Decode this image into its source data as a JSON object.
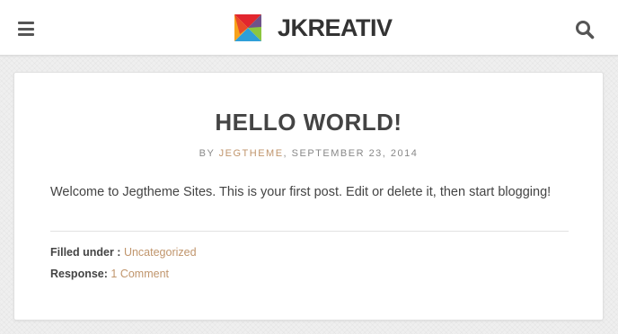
{
  "header": {
    "site_name": "JKREATIV",
    "logo_colors": [
      "#e2262e",
      "#f7a21b",
      "#2f9fd8",
      "#8cc63f",
      "#6a3d98"
    ]
  },
  "post": {
    "title": "HELLO WORLD!",
    "meta": {
      "by_label": "BY",
      "author": "JEGTHEME",
      "date": ", SEPTEMBER 23, 2014"
    },
    "body": "Welcome to Jegtheme Sites. This is your first post. Edit or delete it, then start blogging!",
    "footer": {
      "filled_label": "Filled under :",
      "category": "Uncategorized",
      "response_label": "Response:",
      "comments": "1 Comment"
    }
  },
  "colors": {
    "link": "#c0956c",
    "title": "#444444",
    "background": "#efefef"
  }
}
